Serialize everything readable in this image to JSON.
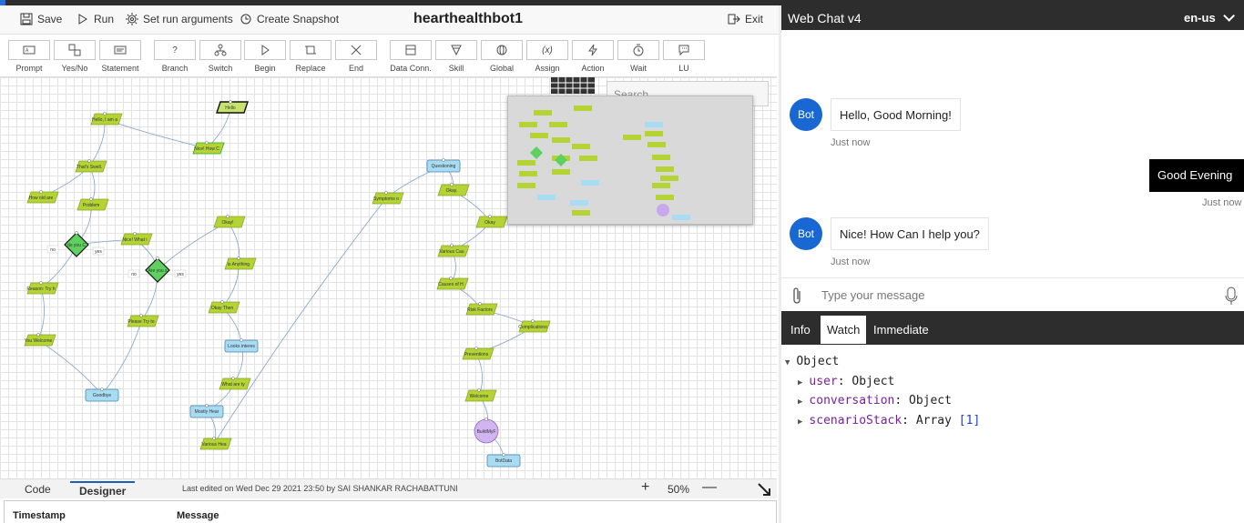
{
  "designer": {
    "title": "hearthealthbot1",
    "toolbar": {
      "save": "Save",
      "run": "Run",
      "set_run_arguments": "Set run arguments",
      "create_snapshot": "Create Snapshot",
      "exit": "Exit"
    },
    "tools": [
      "Prompt",
      "Yes/No",
      "Statement",
      "Branch",
      "Switch",
      "Begin",
      "Replace",
      "End",
      "Data Conn.",
      "Skill",
      "Global",
      "Assign",
      "Action",
      "Wait",
      "LU"
    ],
    "search_placeholder": "Search",
    "tabs": {
      "code": "Code",
      "designer": "Designer"
    },
    "last_edited": "Last edited on Wed Dec 29 2021 23:50 by SAI SHANKAR RACHABATTUNI",
    "zoom": "50%",
    "grid_headers": {
      "timestamp": "Timestamp",
      "message": "Message"
    },
    "flow_nodes": [
      "Hello",
      "Hello, I am a",
      "Nice! How C",
      "That's Swell.",
      "How old are",
      "Problem",
      "do you C",
      "Nice! What i",
      "Reason: Try h",
      "Are you s",
      "Please Try to",
      "You Welcome",
      "Goodbye",
      "Okay!",
      "is Anything",
      "Okay Then",
      "Looks interes",
      "What are ty",
      "Mostly Hear",
      "Various Hea",
      "Symptoms o",
      "Questioning",
      "Okay.",
      "Okay",
      "Various Cau",
      "Causes of H",
      "Risk Factors",
      "Complications",
      "Preventions",
      "Welcome",
      "BuildMyF",
      "BotData"
    ],
    "flow_branch_labels": [
      "no",
      "yes"
    ]
  },
  "webchat": {
    "title": "Web Chat v4",
    "locale": "en-us",
    "messages": [
      {
        "from": "bot",
        "avatar": "Bot",
        "text": "Hello, Good Morning!",
        "time": "Just now"
      },
      {
        "from": "user",
        "text": "Good Evening",
        "time": "Just now"
      },
      {
        "from": "bot",
        "avatar": "Bot",
        "text": "Nice! How Can I help you?",
        "time": "Just now"
      }
    ],
    "input_placeholder": "Type your message"
  },
  "debug": {
    "tabs": [
      "Info",
      "Watch",
      "Immediate"
    ],
    "active_tab": "Watch",
    "root": "Object",
    "entries": [
      {
        "key": "user",
        "value": "Object",
        "extra": ""
      },
      {
        "key": "conversation",
        "value": "Object",
        "extra": ""
      },
      {
        "key": "scenarioStack",
        "value": "Array",
        "extra": "[1]"
      }
    ]
  },
  "colors": {
    "node_green": "#b4d335",
    "node_blue": "#a8dcf3",
    "decision": "#5ed05e",
    "bot_avatar": "#1967d2",
    "user_bubble": "#000000"
  }
}
